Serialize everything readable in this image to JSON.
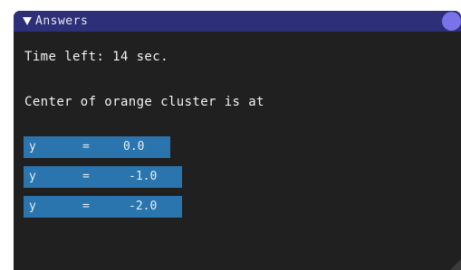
{
  "window": {
    "title": "Answers",
    "collapse_icon": "triangle-down-icon",
    "close_icon": "close-circle-icon",
    "title_bar_color": "#2d2f78",
    "background_color": "#202020",
    "close_button_color": "#7a72e8"
  },
  "content": {
    "timer_text": "Time left: 14 sec.",
    "question_text": "Center of orange cluster is at"
  },
  "answers": [
    {
      "variable": "y",
      "operator": "=",
      "value": "0.0"
    },
    {
      "variable": "y",
      "operator": "=",
      "value": "-1.0"
    },
    {
      "variable": "y",
      "operator": "=",
      "value": "-2.0"
    }
  ],
  "answer_button_color": "#2a75ad"
}
